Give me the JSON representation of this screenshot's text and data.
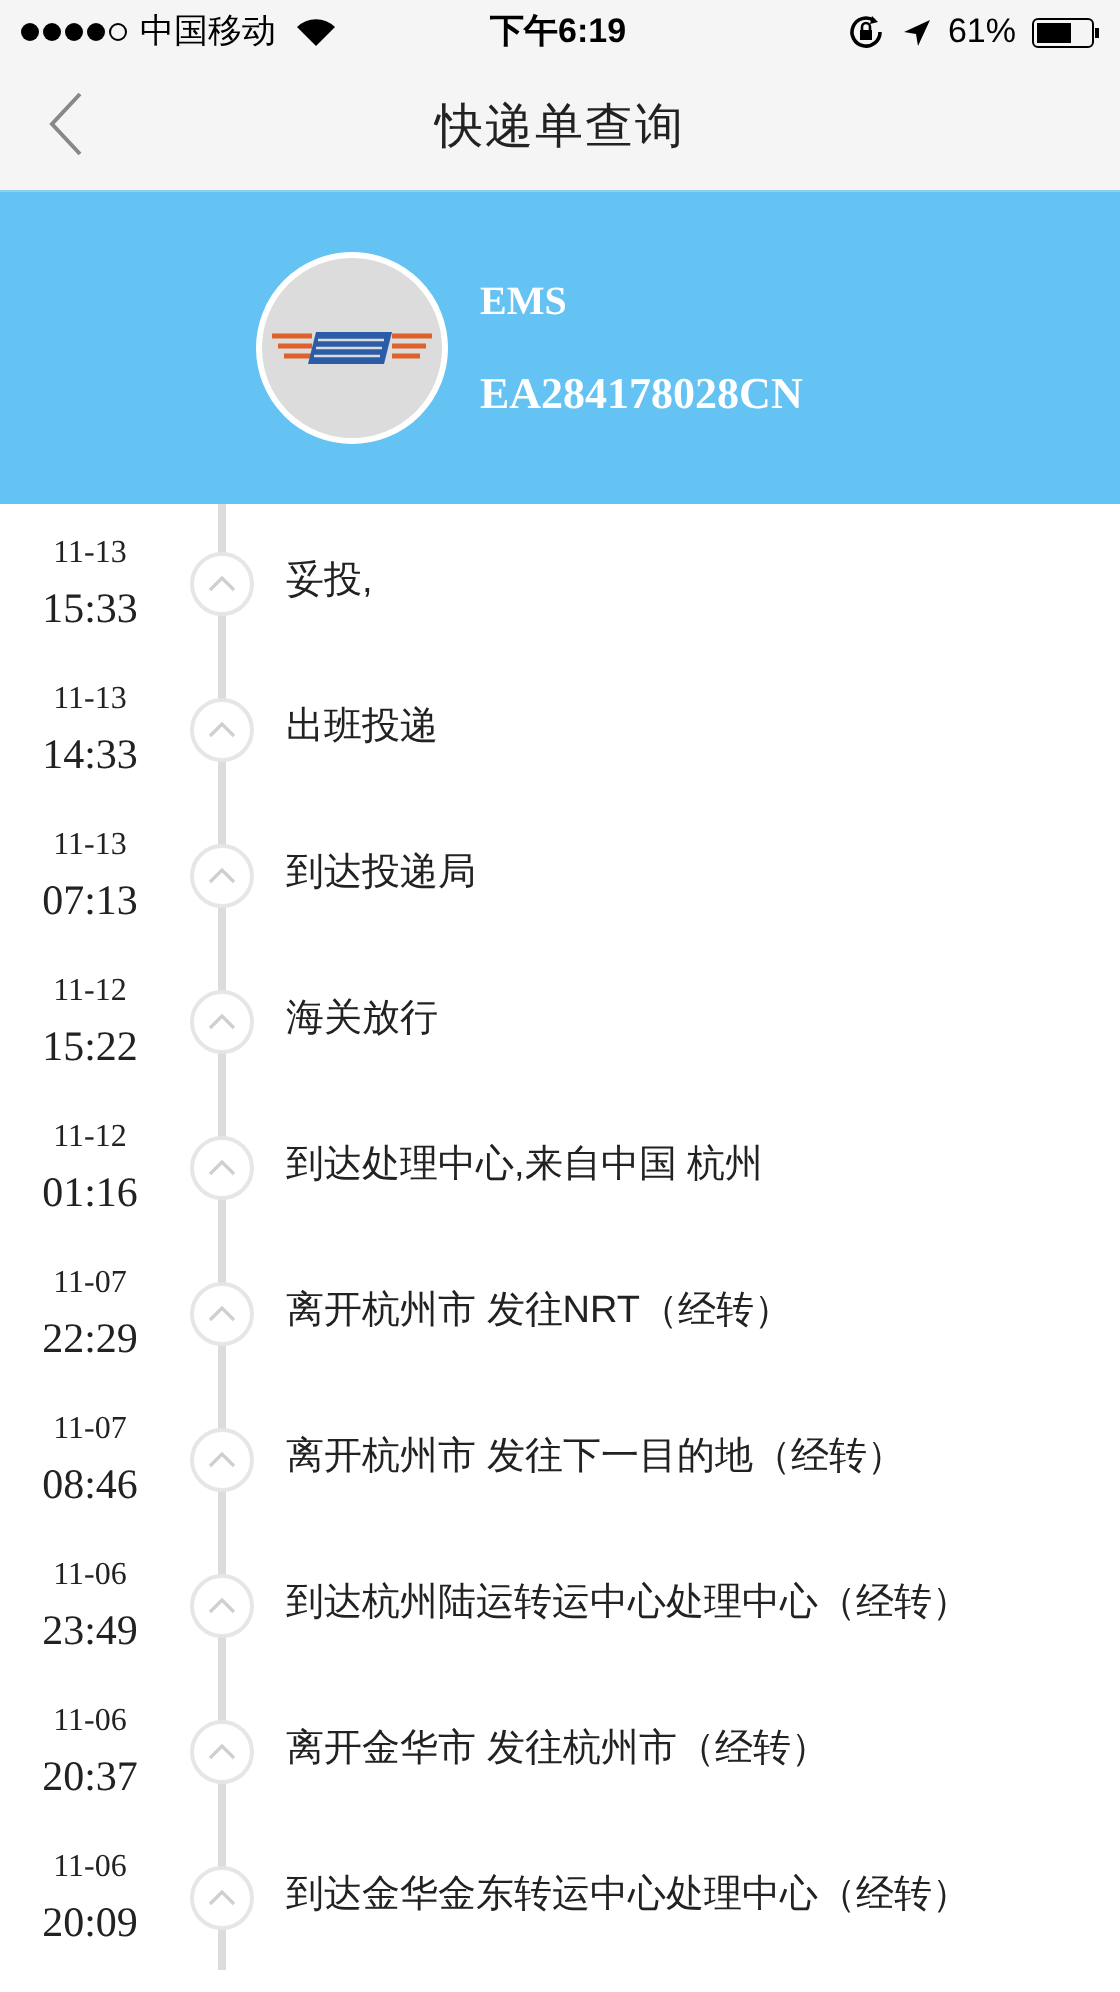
{
  "status_bar": {
    "carrier": "中国移动",
    "time": "下午6:19",
    "battery": "61%"
  },
  "nav": {
    "title": "快递单查询"
  },
  "shipment": {
    "company": "EMS",
    "tracking_number": "EA284178028CN"
  },
  "events": [
    {
      "date": "11-13",
      "time": "15:33",
      "text": "妥投,"
    },
    {
      "date": "11-13",
      "time": "14:33",
      "text": "出班投递"
    },
    {
      "date": "11-13",
      "time": "07:13",
      "text": "到达投递局"
    },
    {
      "date": "11-12",
      "time": "15:22",
      "text": "海关放行"
    },
    {
      "date": "11-12",
      "time": "01:16",
      "text": "到达处理中心,来自中国 杭州"
    },
    {
      "date": "11-07",
      "time": "22:29",
      "text": "离开杭州市 发往NRT（经转）"
    },
    {
      "date": "11-07",
      "time": "08:46",
      "text": "离开杭州市 发往下一目的地（经转）"
    },
    {
      "date": "11-06",
      "time": "23:49",
      "text": "到达杭州陆运转运中心处理中心（经转）"
    },
    {
      "date": "11-06",
      "time": "20:37",
      "text": "离开金华市 发往杭州市（经转）"
    },
    {
      "date": "11-06",
      "time": "20:09",
      "text": "到达金华金东转运中心处理中心（经转）"
    }
  ]
}
